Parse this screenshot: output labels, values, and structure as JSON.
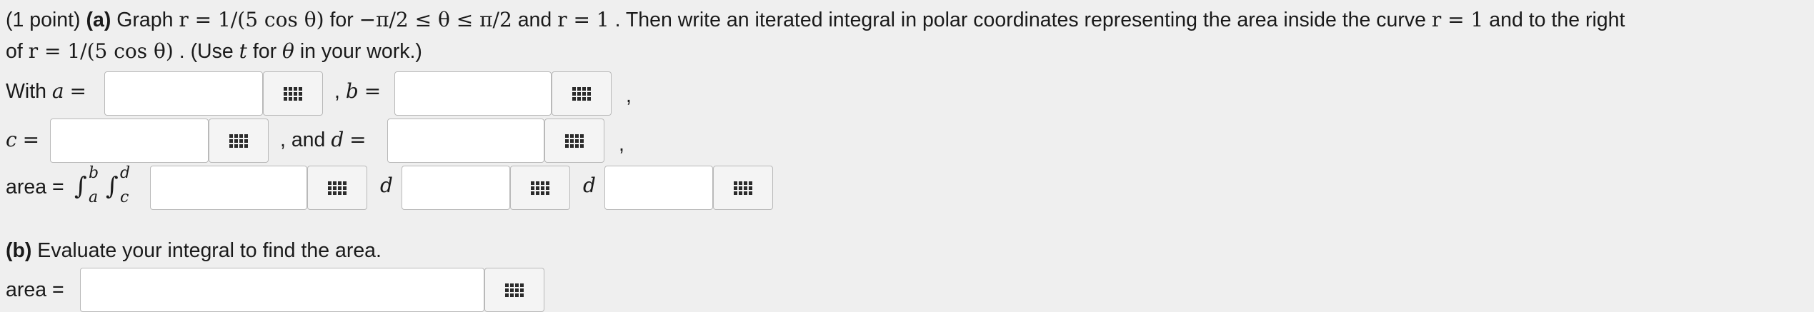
{
  "part_a": {
    "points": "(1 point)",
    "label": "(a)",
    "line1": {
      "t1": " Graph ",
      "m1": "r = 1/(5 cos θ)",
      "t2": " for ",
      "m2": "−π/2 ≤ θ ≤ π/2",
      "t3": " and ",
      "m3": "r = 1",
      "t4": ". Then write an iterated integral in polar coordinates representing the area inside the curve ",
      "m4": "r = 1",
      "t5": " and to the right"
    },
    "line2": {
      "t1": "of ",
      "m1": "r = 1/(5 cos θ)",
      "t2": ". (Use ",
      "m2": "t",
      "t3": " for ",
      "m3": "θ",
      "t4": " in your work.)"
    }
  },
  "row_ab": {
    "with_text": "With ",
    "a_var": "a",
    "eq": "=",
    "comma_b": ",",
    "b_var": "b",
    "eq2": "=",
    "trail": ","
  },
  "row_cd": {
    "c_var": "c",
    "eq": "=",
    "and_text": ", and ",
    "d_var": "d",
    "eq2": "=",
    "trail": ","
  },
  "row_area": {
    "area_label": "area =",
    "b_upper": "b",
    "a_lower": "a",
    "d_upper": "d",
    "c_lower": "c",
    "d1": "d",
    "d2": "d"
  },
  "part_b": {
    "label": "(b)",
    "text": " Evaluate your integral to find the area.",
    "area_label": "area ="
  },
  "inputs": {
    "a": "",
    "b": "",
    "c": "",
    "d": "",
    "integrand": "",
    "var1": "",
    "var2": "",
    "area": ""
  },
  "icons": {
    "palette": "grid-palette-icon"
  }
}
